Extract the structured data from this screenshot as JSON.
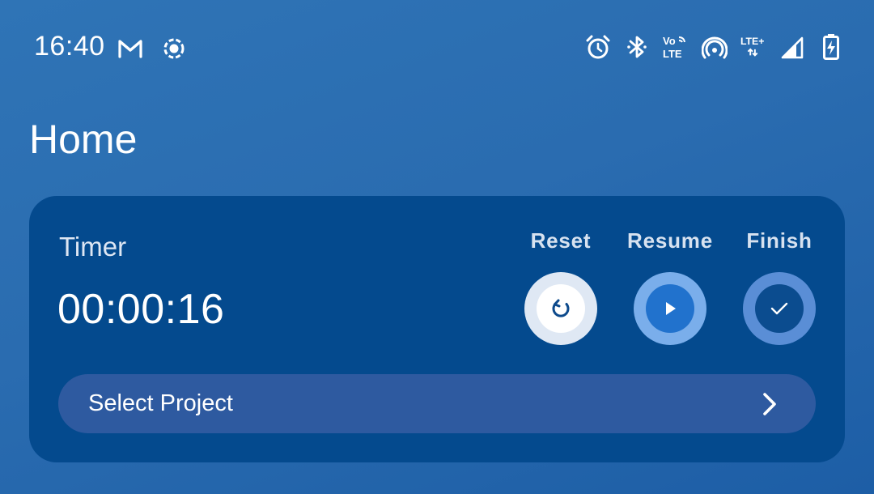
{
  "status_bar": {
    "time": "16:40",
    "left_icons": [
      "gmail-icon",
      "record-icon"
    ],
    "right_icons": [
      "alarm-icon",
      "bluetooth-icon",
      "volte-icon",
      "hotspot-icon",
      "lte-plus-icon",
      "signal-icon",
      "battery-charging-icon"
    ],
    "volte_line1": "Vo",
    "volte_line2": "LTE",
    "lte_plus": "LTE+"
  },
  "page": {
    "title": "Home"
  },
  "timer_card": {
    "label": "Timer",
    "value": "00:00:16",
    "actions": [
      {
        "label": "Reset",
        "icon": "reset-icon"
      },
      {
        "label": "Resume",
        "icon": "play-icon"
      },
      {
        "label": "Finish",
        "icon": "check-icon"
      }
    ],
    "select_project": {
      "label": "Select Project",
      "icon": "chevron-right-icon"
    }
  },
  "colors": {
    "background": "#2a6cb0",
    "card": "#044a8e",
    "select_project_bg": "#2e5aa0",
    "resume_accent": "#2172cd"
  }
}
